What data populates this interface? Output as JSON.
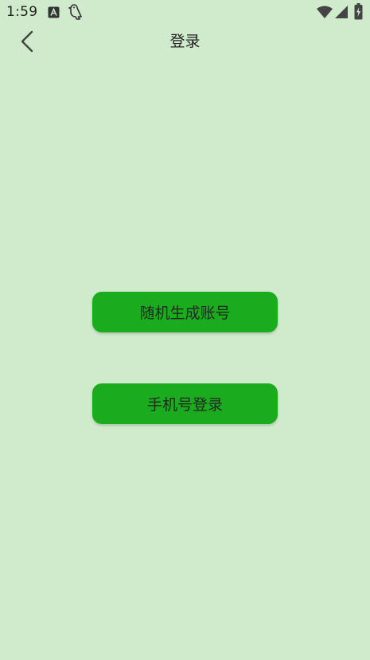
{
  "status_bar": {
    "time": "1:59",
    "icons": [
      "keyboard-a-icon",
      "bird-notification-icon",
      "wifi-icon",
      "cellular-signal-icon",
      "battery-charging-icon"
    ]
  },
  "header": {
    "title": "登录",
    "back_icon": "chevron-left-icon"
  },
  "actions": {
    "random_account_label": "随机生成账号",
    "phone_login_label": "手机号登录"
  },
  "colors": {
    "background": "#d0ebcb",
    "button": "#1aab1f",
    "text": "#222222"
  }
}
